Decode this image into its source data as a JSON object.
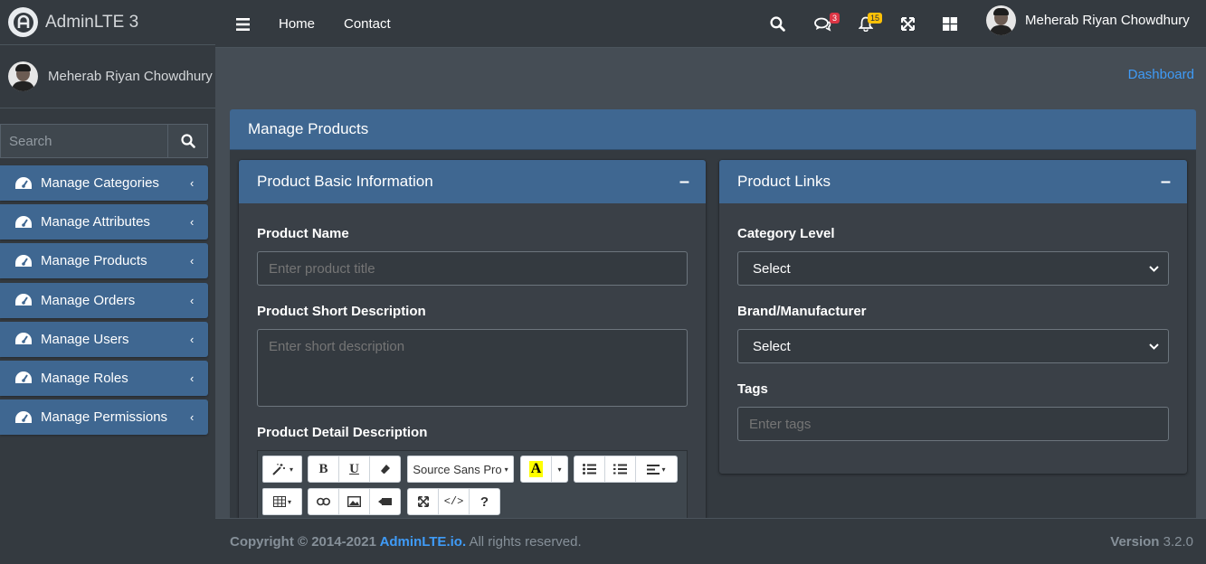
{
  "brand": {
    "name": "AdminLTE 3",
    "logo_icon": "adminlte-logo-icon"
  },
  "sidebar": {
    "user_name": "Meherab Riyan Chowdhury",
    "search_placeholder": "Search",
    "items": [
      {
        "label": "Manage Categories",
        "icon": "tachometer-icon"
      },
      {
        "label": "Manage Attributes",
        "icon": "tachometer-icon"
      },
      {
        "label": "Manage Products",
        "icon": "tachometer-icon"
      },
      {
        "label": "Manage Orders",
        "icon": "tachometer-icon"
      },
      {
        "label": "Manage Users",
        "icon": "tachometer-icon"
      },
      {
        "label": "Manage Roles",
        "icon": "tachometer-icon"
      },
      {
        "label": "Manage Permissions",
        "icon": "tachometer-icon"
      }
    ],
    "arrow": "‹"
  },
  "topbar": {
    "nav": [
      "Home",
      "Contact"
    ],
    "messages_count": "3",
    "notifications_count": "15",
    "user_name": "Meherab Riyan Chowdhury"
  },
  "breadcrumb": "Dashboard",
  "main_card": {
    "title": "Manage Products"
  },
  "basic_info": {
    "title": "Product Basic Information",
    "name_label": "Product Name",
    "name_placeholder": "Enter product title",
    "short_desc_label": "Product Short Description",
    "short_desc_placeholder": "Enter short description",
    "detail_desc_label": "Product Detail Description",
    "font_name": "Source Sans Pro"
  },
  "links": {
    "title": "Product Links",
    "category_label": "Category Level",
    "category_value": "Select",
    "brand_label": "Brand/Manufacturer",
    "brand_value": "Select",
    "tags_label": "Tags",
    "tags_placeholder": "Enter tags"
  },
  "footer": {
    "copyright": "Copyright © 2014-2021 ",
    "link": "AdminLTE.io.",
    "rights": " All rights reserved.",
    "version_label": "Version",
    "version": " 3.2.0"
  },
  "colors": {
    "accent": "#3f6791",
    "link": "#3f9bf7",
    "sidebar": "#343a40",
    "content_bg": "#454d55"
  }
}
